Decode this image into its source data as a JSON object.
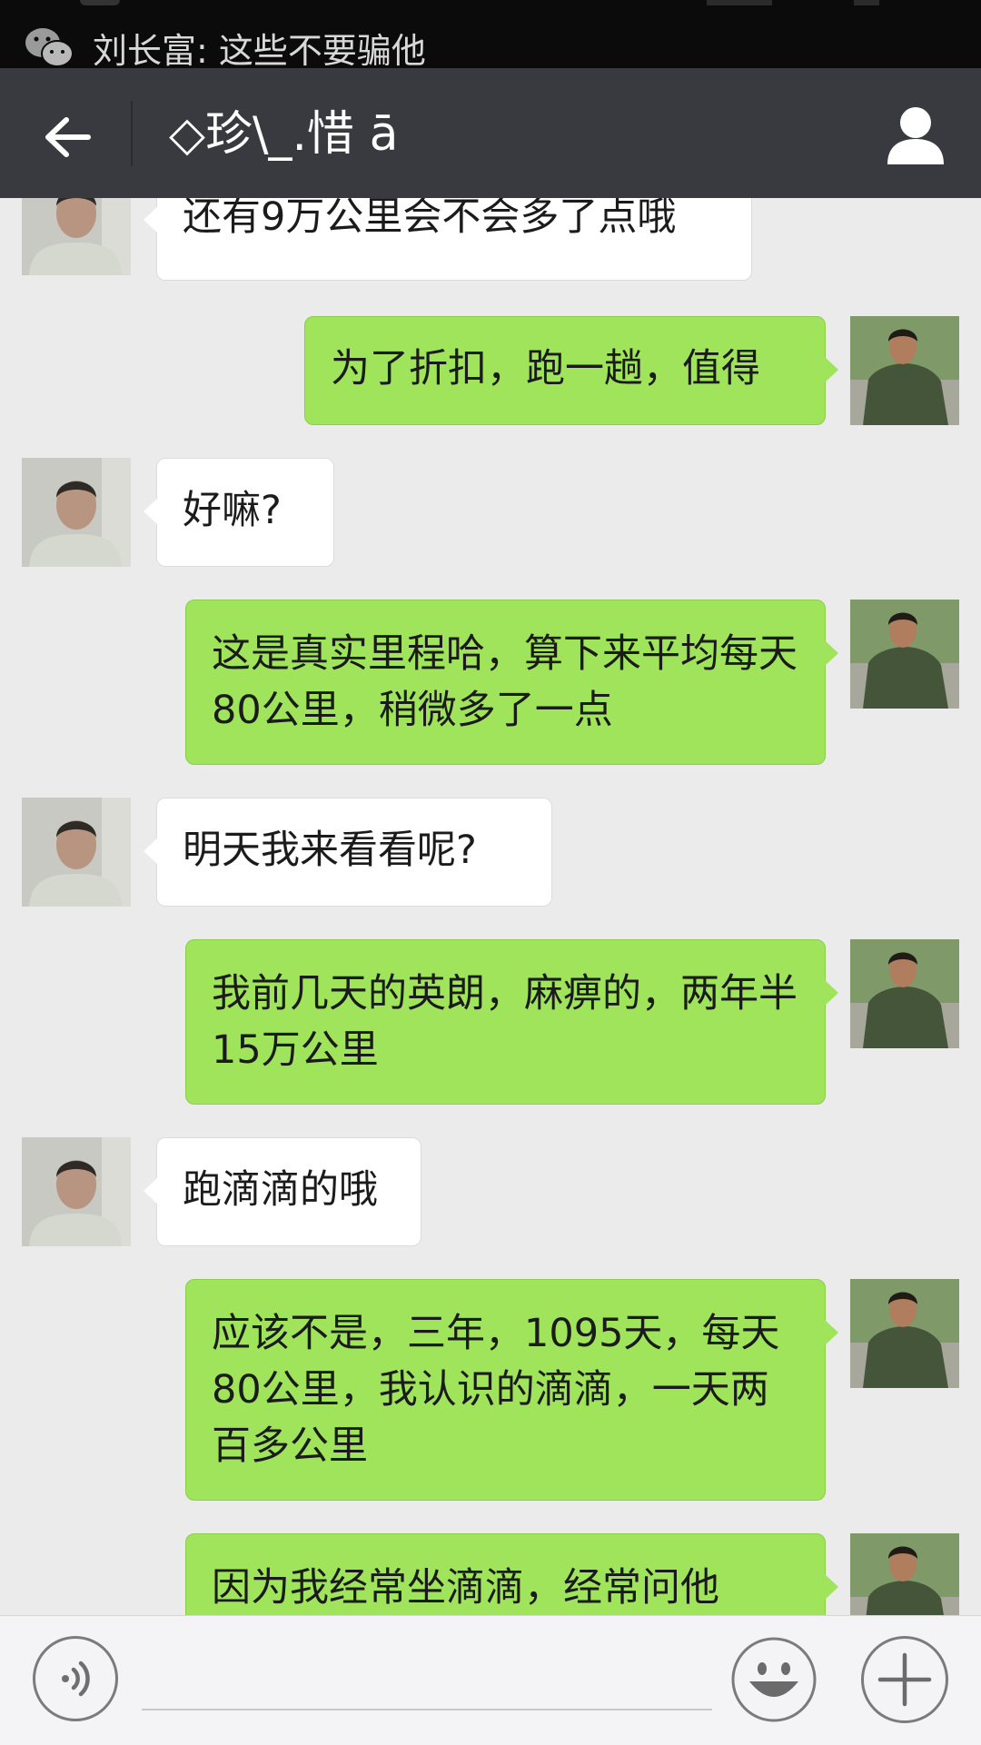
{
  "notification": {
    "text": "刘长富: 这些不要骗他",
    "icon": "wechat-icon"
  },
  "header": {
    "title": "◇珍\\_.惜 ā",
    "back_icon": "back-arrow-icon",
    "profile_icon": "user-profile-icon"
  },
  "messages": [
    {
      "side": "in",
      "text": "还有9万公里会不会多了点哦"
    },
    {
      "side": "out",
      "text": "为了折扣，跑一趟，值得"
    },
    {
      "side": "in",
      "text": "好嘛?"
    },
    {
      "side": "out",
      "text": "这是真实里程哈，算下来平均每天80公里，稍微多了一点"
    },
    {
      "side": "in",
      "text": "明天我来看看呢?"
    },
    {
      "side": "out",
      "text": "我前几天的英朗，麻痹的，两年半15万公里"
    },
    {
      "side": "in",
      "text": "跑滴滴的哦"
    },
    {
      "side": "out",
      "text": "应该不是，三年，1095天，每天80公里，我认识的滴滴，一天两百多公里"
    },
    {
      "side": "out",
      "text": "因为我经常坐滴滴，经常问他"
    }
  ],
  "input_bar": {
    "voice_icon": "voice-icon",
    "input_value": "",
    "emoji_icon": "emoji-icon",
    "more_icon": "plus-icon"
  },
  "colors": {
    "title_bar": "#393a3f",
    "sent_bubble": "#9fe45b",
    "received_bubble": "#ffffff",
    "chat_bg": "#ebebeb"
  }
}
